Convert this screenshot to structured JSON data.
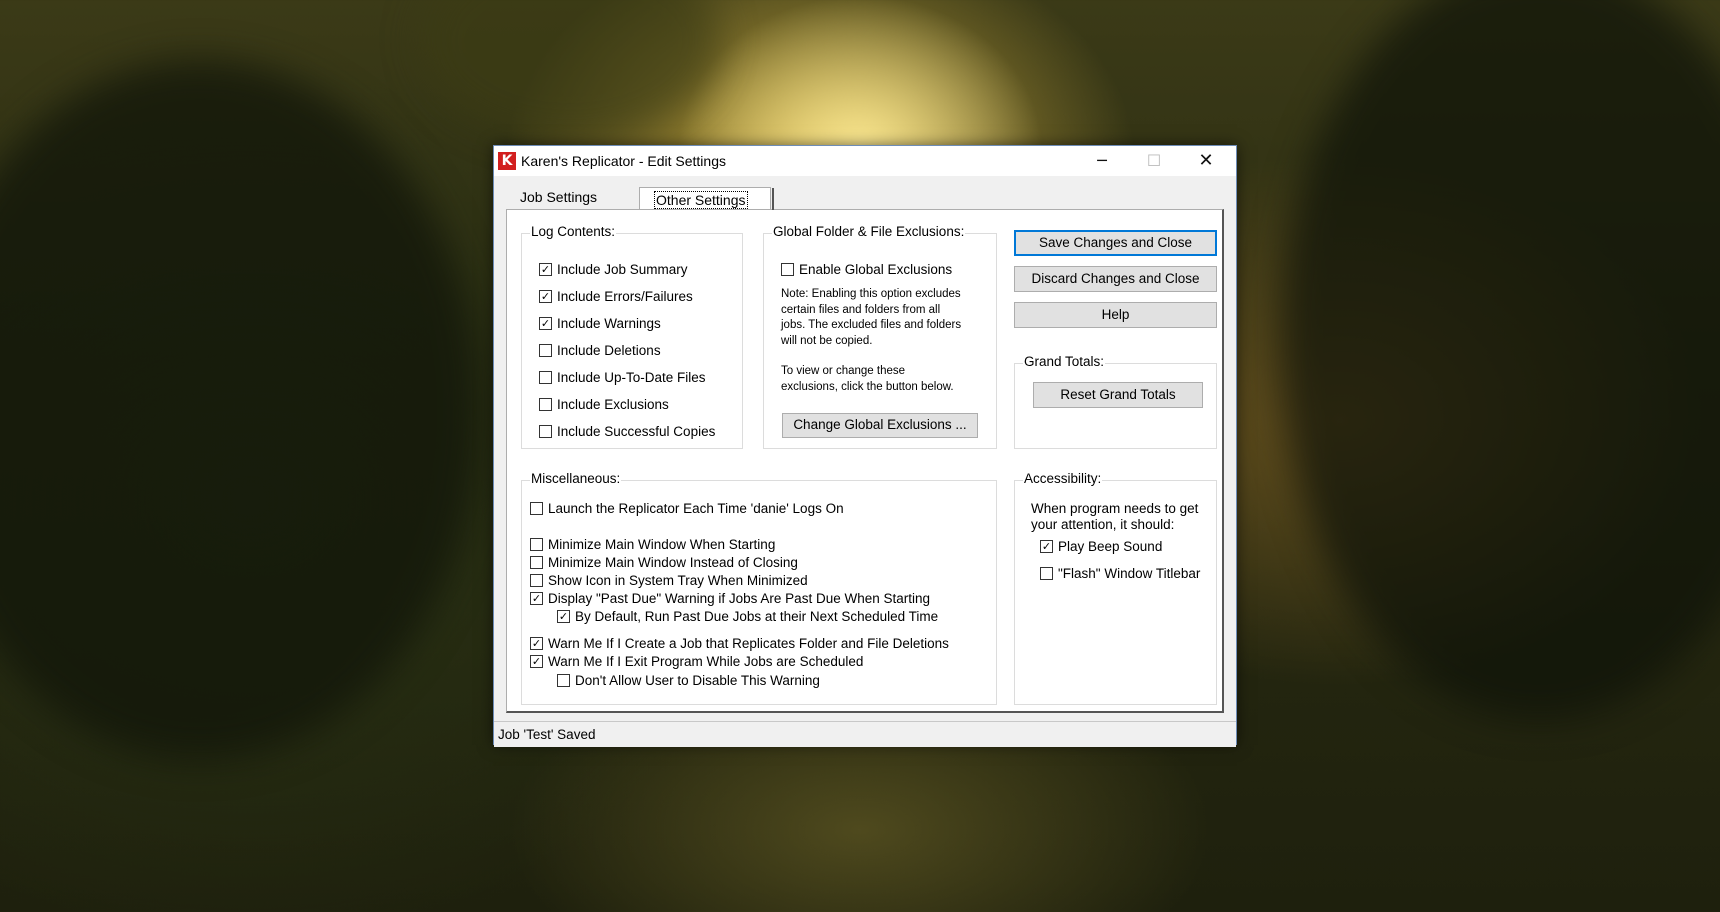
{
  "window": {
    "app_icon_letter": "K",
    "title": "Karen's Replicator - Edit Settings",
    "minimize_glyph": "─",
    "maximize_glyph": "☐",
    "close_glyph": "✕"
  },
  "tabs": [
    {
      "label": "Job Settings",
      "selected": false
    },
    {
      "label": "Other Settings",
      "selected": true
    }
  ],
  "log_contents": {
    "title": "Log Contents:",
    "items": [
      {
        "label": "Include Job Summary",
        "checked": true
      },
      {
        "label": "Include Errors/Failures",
        "checked": true
      },
      {
        "label": "Include Warnings",
        "checked": true
      },
      {
        "label": "Include Deletions",
        "checked": false
      },
      {
        "label": "Include Up-To-Date Files",
        "checked": false
      },
      {
        "label": "Include Exclusions",
        "checked": false
      },
      {
        "label": "Include Successful Copies",
        "checked": false
      }
    ]
  },
  "global_exclusions": {
    "title": "Global Folder & File Exclusions:",
    "enable_label": "Enable Global Exclusions",
    "enable_checked": false,
    "note_lines": [
      "Note: Enabling this option excludes",
      "certain files and folders from all",
      "jobs. The excluded files and folders",
      "will not be copied."
    ],
    "view_lines": [
      "To view or change these",
      "exclusions, click the button below."
    ],
    "change_button": "Change Global Exclusions ..."
  },
  "actions": {
    "save": "Save Changes and Close",
    "discard": "Discard Changes and Close",
    "help": "Help"
  },
  "grand_totals": {
    "title": "Grand Totals:",
    "reset_button": "Reset Grand Totals"
  },
  "miscellaneous": {
    "title": "Miscellaneous:",
    "items": [
      {
        "label": "Launch the Replicator Each Time 'danie' Logs On",
        "checked": false
      },
      {
        "label": "Minimize Main Window When Starting",
        "checked": false
      },
      {
        "label": "Minimize Main Window Instead of Closing",
        "checked": false
      },
      {
        "label": "Show Icon in System Tray When Minimized",
        "checked": false
      },
      {
        "label": "Display \"Past Due\" Warning if Jobs Are Past Due When Starting",
        "checked": true
      },
      {
        "label": "By Default, Run Past Due Jobs at their Next Scheduled Time",
        "checked": true
      },
      {
        "label": "Warn Me If I Create a Job that Replicates Folder and File Deletions",
        "checked": true
      },
      {
        "label": "Warn Me If I Exit Program While Jobs are Scheduled",
        "checked": true
      },
      {
        "label": "Don't Allow User to Disable This Warning",
        "checked": false
      }
    ]
  },
  "accessibility": {
    "title": "Accessibility:",
    "prompt_lines": [
      "When program needs to get",
      "your attention, it should:"
    ],
    "items": [
      {
        "label": "Play Beep Sound",
        "checked": true
      },
      {
        "label": "\"Flash\" Window Titlebar",
        "checked": false
      }
    ]
  },
  "status": {
    "text": "Job 'Test' Saved"
  },
  "colors": {
    "accent_border": "#0078d7",
    "app_icon_red": "#d21f1f"
  }
}
